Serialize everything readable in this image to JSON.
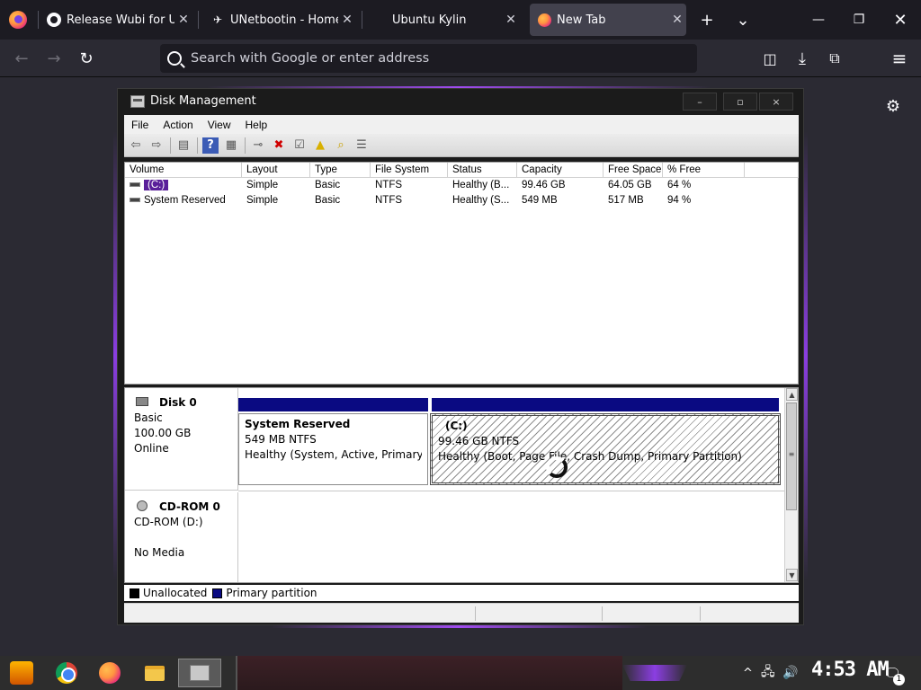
{
  "browser": {
    "tabs": [
      {
        "label": "Release Wubi for Ubu",
        "icon": "github-icon"
      },
      {
        "label": "UNetbootin - Homepa",
        "icon": "unetbootin-icon"
      },
      {
        "label": "Ubuntu Kylin",
        "icon": ""
      },
      {
        "label": "New Tab",
        "icon": "firefox-icon",
        "active": true
      }
    ],
    "close_glyph": "✕",
    "new_tab_glyph": "+",
    "list_tabs_glyph": "⌄",
    "window_controls": {
      "minimize": "—",
      "restore": "❐",
      "close": "✕"
    },
    "nav": {
      "back": "←",
      "forward": "→",
      "reload": "↻"
    },
    "search_placeholder": "Search with Google or enter address",
    "toolbar_icons": {
      "pocket": "◫",
      "downloads": "⤓",
      "extensions": "⧉",
      "menu": "≡"
    },
    "settings_glyph": "⚙"
  },
  "disk_management": {
    "title": "Disk Management",
    "window_controls": {
      "minimize": "–",
      "restore": "▫",
      "close": "×"
    },
    "menu": [
      "File",
      "Action",
      "View",
      "Help"
    ],
    "table": {
      "columns": [
        "Volume",
        "Layout",
        "Type",
        "File System",
        "Status",
        "Capacity",
        "Free Space",
        "% Free"
      ],
      "rows": [
        {
          "volume": "(C:)",
          "layout": "Simple",
          "type": "Basic",
          "fs": "NTFS",
          "status": "Healthy (B...",
          "capacity": "99.46 GB",
          "free": "64.05 GB",
          "pct": "64 %"
        },
        {
          "volume": "System Reserved",
          "layout": "Simple",
          "type": "Basic",
          "fs": "NTFS",
          "status": "Healthy (S...",
          "capacity": "549 MB",
          "free": "517 MB",
          "pct": "94 %"
        }
      ]
    },
    "disks": [
      {
        "name": "Disk 0",
        "type": "Basic",
        "size": "100.00 GB",
        "state": "Online",
        "partitions": [
          {
            "name": "System Reserved",
            "size": "549 MB NTFS",
            "status": "Healthy (System, Active, Primary Pa"
          },
          {
            "name": "(C:)",
            "size": "99.46 GB NTFS",
            "status": "Healthy (Boot, Page File, Crash Dump, Primary Partition)"
          }
        ]
      },
      {
        "name": "CD-ROM 0",
        "type": "CD-ROM (D:)",
        "state": "No Media"
      }
    ],
    "legend": [
      {
        "label": "Unallocated",
        "color": "#000000"
      },
      {
        "label": "Primary partition",
        "color": "#0a0a82"
      }
    ]
  },
  "taskbar": {
    "clock": "4:53 AM",
    "notification_count": "1",
    "tray_glyphs": {
      "chevron": "^",
      "network": "🖧",
      "volume": "🔊",
      "notifications": "🗨"
    }
  },
  "colors": {
    "accent_purple": "#8b3ee2",
    "partition_bar": "#0a0a82",
    "selection": "#5a1f9a"
  }
}
